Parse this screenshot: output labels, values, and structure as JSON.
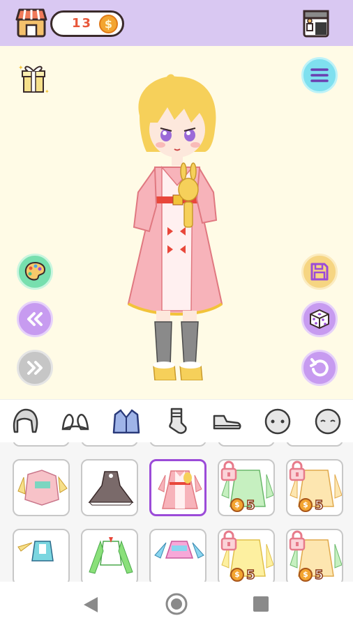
{
  "header": {
    "coins": "13",
    "coin_symbol": "$"
  },
  "tabs": [
    {
      "name": "hair"
    },
    {
      "name": "accessory"
    },
    {
      "name": "top"
    },
    {
      "name": "socks"
    },
    {
      "name": "shoes"
    },
    {
      "name": "face"
    },
    {
      "name": "expression"
    }
  ],
  "items": [
    {
      "locked": false,
      "price": "",
      "selected": false
    },
    {
      "locked": false,
      "price": "",
      "selected": false
    },
    {
      "locked": false,
      "price": "",
      "selected": true
    },
    {
      "locked": true,
      "price": "5",
      "selected": false
    },
    {
      "locked": true,
      "price": "5",
      "selected": false
    },
    {
      "locked": false,
      "price": "",
      "selected": false
    },
    {
      "locked": false,
      "price": "",
      "selected": false
    },
    {
      "locked": false,
      "price": "",
      "selected": false
    },
    {
      "locked": true,
      "price": "5",
      "selected": false
    },
    {
      "locked": true,
      "price": "5",
      "selected": false
    }
  ],
  "price_coin_symbol": "$",
  "colors": {
    "topbar": "#d9c8f2",
    "stage": "#fffbe6",
    "accent_purple": "#c79bf0",
    "accent_cyan": "#7fe0ef",
    "accent_green": "#77dfae",
    "accent_yellow": "#f6d582",
    "selected_border": "#9b4bd8"
  }
}
